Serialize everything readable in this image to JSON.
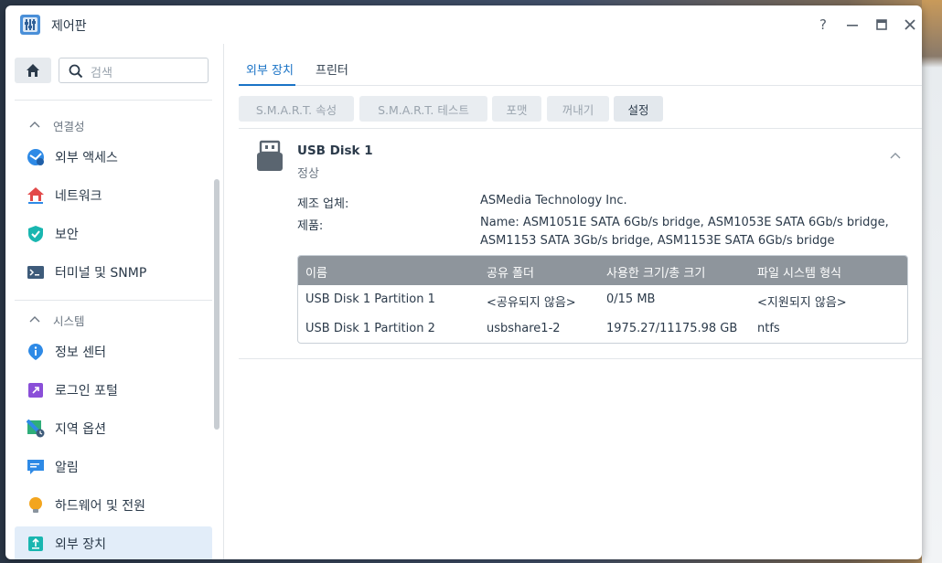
{
  "window": {
    "title": "제어판"
  },
  "sidebar": {
    "search_placeholder": "검색",
    "sections": [
      {
        "label": "연결성",
        "items": [
          {
            "label": "외부 액세스",
            "icon": "external-access-icon"
          },
          {
            "label": "네트워크",
            "icon": "network-icon"
          },
          {
            "label": "보안",
            "icon": "security-shield-icon"
          },
          {
            "label": "터미널 및 SNMP",
            "icon": "terminal-icon"
          }
        ]
      },
      {
        "label": "시스템",
        "items": [
          {
            "label": "정보 센터",
            "icon": "info-icon"
          },
          {
            "label": "로그인 포털",
            "icon": "login-portal-icon"
          },
          {
            "label": "지역 옵션",
            "icon": "regional-options-icon"
          },
          {
            "label": "알림",
            "icon": "notification-icon"
          },
          {
            "label": "하드웨어 및 전원",
            "icon": "hardware-power-icon"
          },
          {
            "label": "외부 장치",
            "icon": "external-device-icon",
            "active": true
          }
        ]
      }
    ]
  },
  "main": {
    "tabs": [
      {
        "label": "외부 장치",
        "active": true
      },
      {
        "label": "프린터",
        "active": false
      }
    ],
    "toolbar": {
      "smart_attr": "S.M.A.R.T. 속성",
      "smart_test": "S.M.A.R.T. 테스트",
      "format": "포맷",
      "eject": "꺼내기",
      "settings": "설정"
    },
    "device": {
      "name": "USB Disk 1",
      "status": "정상",
      "manufacturer_label": "제조 업체:",
      "manufacturer_value": "ASMedia Technology Inc.",
      "product_label": "제품:",
      "product_value": "Name: ASM1051E SATA 6Gb/s bridge, ASM1053E SATA 6Gb/s bridge, ASM1153 SATA 3Gb/s bridge, ASM1153E SATA 6Gb/s bridge",
      "partitions": {
        "columns": [
          "이름",
          "공유 폴더",
          "사용한 크기/총 크기",
          "파일 시스템 형식"
        ],
        "rows": [
          [
            "USB Disk 1 Partition 1",
            "<공유되지 않음>",
            "0/15 MB",
            "<지원되지 않음>"
          ],
          [
            "USB Disk 1 Partition 2",
            "usbshare1-2",
            "1975.27/11175.98 GB",
            "ntfs"
          ]
        ]
      }
    }
  },
  "colors": {
    "accent": "#1a73c6",
    "active_nav_bg": "#e2edf9",
    "table_header": "#8e959c"
  }
}
